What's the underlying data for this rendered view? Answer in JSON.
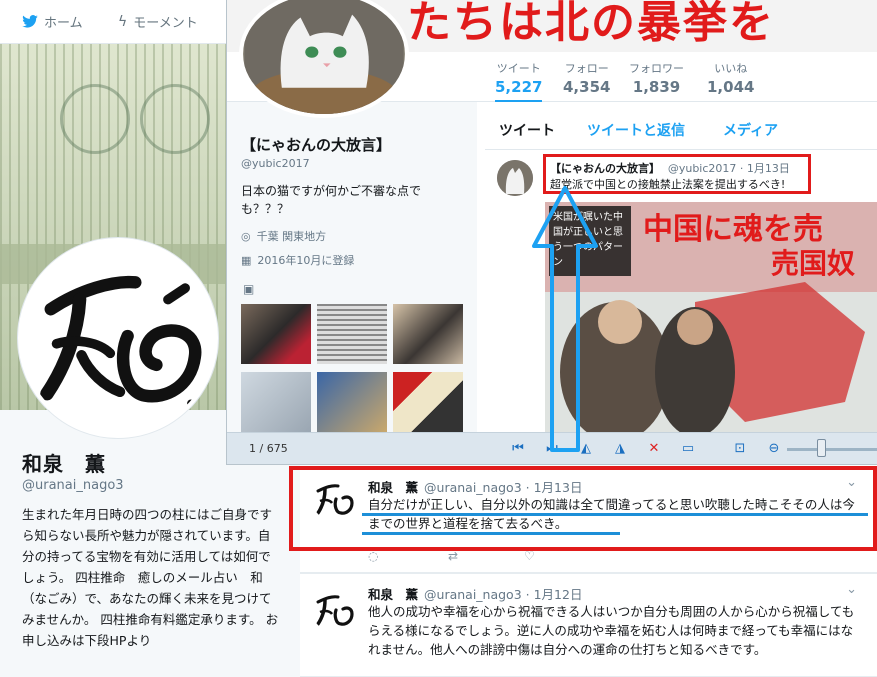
{
  "topnav": {
    "home": "ホーム",
    "moments": "モーメント"
  },
  "profile": {
    "name": "和泉　薫",
    "handle": "@uranai_nago3",
    "bio": "生まれた年月日時の四つの柱にはご自身ですら知らない長所や魅力が隠されています。自分の持ってる宝物を有効に活用しては如何でしょう。 四柱推命　癒しのメール占い　和（なごみ）で、あなたの輝く未来を見つけてみませんか。 四柱推命有料鑑定承ります。 お申し込みは下段HPより"
  },
  "lightbox": {
    "banner_text": "たちは北の暴挙を",
    "stats": [
      {
        "label": "ツイート",
        "value": "5,227",
        "active": true
      },
      {
        "label": "フォロー",
        "value": "4,354",
        "active": false
      },
      {
        "label": "フォロワー",
        "value": "1,839",
        "active": false
      },
      {
        "label": "いいね",
        "value": "1,044",
        "active": false
      }
    ],
    "name": "【にゃおんの大放言】",
    "handle": "@yubic2017",
    "bio": "日本の猫ですが何かご不審な点でも？？？",
    "location": "千葉 関東地方",
    "joined": "2016年10月に登録",
    "tabs": [
      "ツイート",
      "ツイートと返信",
      "メディア"
    ],
    "tweet": {
      "name": "【にゃおんの大放言】",
      "handle_date": "@yubic2017 · 1月13日",
      "text": "超党派で中国との接触禁止法案を提出するべき!",
      "image_headline": "中国に魂を売",
      "image_headline2": "売国奴",
      "image_sub": "米国が嘱いた中国が正しいと思う一つのパターン"
    },
    "counter": "1 / 675"
  },
  "timeline": [
    {
      "name": "和泉　薫",
      "handle_date": "@uranai_nago3 · 1月13日",
      "text": "自分だけが正しい、自分以外の知識は全て間違ってると思い吹聴した時こそその人は今までの世界と道程を捨て去るべき。"
    },
    {
      "name": "和泉　薫",
      "handle_date": "@uranai_nago3 · 1月12日",
      "text": "他人の成功や幸福を心から祝福できる人はいつか自分も周囲の人から心から祝福してもらえる様になるでしょう。逆に人の成功や幸福を妬む人は何時まで経っても幸福にはなれません。他人への誹謗中傷は自分への運命の仕打ちと知るべきです。"
    }
  ],
  "colors": {
    "accent": "#1da1f2",
    "annotation_red": "#e11b1b",
    "annotation_blue": "#1d8fd8"
  }
}
